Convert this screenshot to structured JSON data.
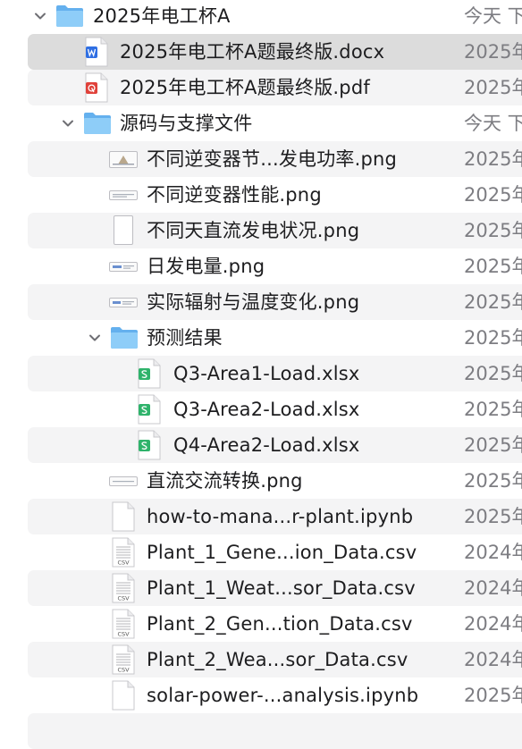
{
  "colors": {
    "folder": "#7ec0f5",
    "word": "#2f6fe3",
    "pdf": "#e0413a",
    "sheet": "#2fb36b",
    "row_alt": "#f4f4f5",
    "row_selected": "#dcdcdc",
    "date_text": "#7d7d82"
  },
  "rows": [
    {
      "name": "2025年电工杯A",
      "date": "今天 下",
      "icon": "folder-icon",
      "expanded": true
    },
    {
      "name": "2025年电工杯A题最终版.docx",
      "date": "2025年",
      "icon": "word-document-icon",
      "selected": true
    },
    {
      "name": "2025年电工杯A题最终版.pdf",
      "date": "2025年",
      "icon": "pdf-document-icon"
    },
    {
      "name": "源码与支撑文件",
      "date": "今天 下",
      "icon": "folder-icon",
      "expanded": true
    },
    {
      "name": "不同逆变器节...发电功率.png",
      "date": "2025年",
      "icon": "image-file-icon"
    },
    {
      "name": "不同逆变器性能.png",
      "date": "2025年",
      "icon": "image-file-icon"
    },
    {
      "name": "不同天直流发电状况.png",
      "date": "2025年",
      "icon": "image-file-icon"
    },
    {
      "name": "日发电量.png",
      "date": "2025年",
      "icon": "image-file-icon"
    },
    {
      "name": "实际辐射与温度变化.png",
      "date": "2025年",
      "icon": "image-file-icon"
    },
    {
      "name": "预测结果",
      "date": "2025年",
      "icon": "folder-icon",
      "expanded": true
    },
    {
      "name": "Q3-Area1-Load.xlsx",
      "date": "2025年",
      "icon": "spreadsheet-file-icon"
    },
    {
      "name": "Q3-Area2-Load.xlsx",
      "date": "2025年",
      "icon": "spreadsheet-file-icon"
    },
    {
      "name": "Q4-Area2-Load.xlsx",
      "date": "2025年",
      "icon": "spreadsheet-file-icon"
    },
    {
      "name": "直流交流转换.png",
      "date": "2025年",
      "icon": "image-file-icon"
    },
    {
      "name": "how-to-mana...r-plant.ipynb",
      "date": "2025年",
      "icon": "notebook-file-icon"
    },
    {
      "name": "Plant_1_Gene...ion_Data.csv",
      "date": "2024年",
      "icon": "csv-file-icon"
    },
    {
      "name": "Plant_1_Weat...sor_Data.csv",
      "date": "2024年",
      "icon": "csv-file-icon"
    },
    {
      "name": "Plant_2_Gen...tion_Data.csv",
      "date": "2024年",
      "icon": "csv-file-icon"
    },
    {
      "name": "Plant_2_Wea...sor_Data.csv",
      "date": "2024年",
      "icon": "csv-file-icon"
    },
    {
      "name": "solar-power-...analysis.ipynb",
      "date": "2025年",
      "icon": "notebook-file-icon"
    }
  ]
}
